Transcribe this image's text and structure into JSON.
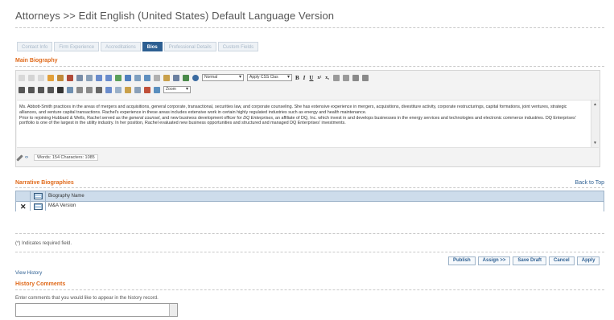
{
  "page": {
    "title": "Attorneys >> Edit English (United States) Default Language Version"
  },
  "tabs": [
    {
      "label": "Contact Info",
      "active": false
    },
    {
      "label": "Firm Experience",
      "active": false
    },
    {
      "label": "Accreditations",
      "active": false
    },
    {
      "label": "Bios",
      "active": true
    },
    {
      "label": "Professional Details",
      "active": false
    },
    {
      "label": "Custom Fields",
      "active": false
    }
  ],
  "main_bio": {
    "title": "Main Biography",
    "style_select": "Normal",
    "css_select": "Apply CSS Clas",
    "zoom_select": "Zoom",
    "bold": "B",
    "italic": "I",
    "underline": "U",
    "superscript": "x²",
    "subscript": "x₂",
    "paragraph1": "Ms. Abbott-Smith practices in the areas of mergers and acquisitions, general corporate, transactional, securities law, and corporate counseling. She has extensive experience in mergers, acquisitions, divestiture activity, corporate restructurings, capital formations, joint ventures, strategic alliances, and venture capital transactions. Rachel's experience in these areas includes extensive work in certain highly regulated industries such as energy and health maintenance.",
    "p2_a": "Prior to rejoining Hubbard & Wells, Rachel served as the ",
    "p2_em1": "general counsel",
    "p2_b": ", and new business development officer for ",
    "p2_em2": "DQ Enterprises",
    "p2_c": ", an affiliate of DQ, Inc. which invest in and develops businesses in the energy services and technologies and electronic commerce industries. DQ Enterprises' portfolio is one of the largest in the utility industry. In her position, Rachel evaluated new business opportunities and structured and managed DQ Enterprises' investments.",
    "word_count": "Words: 154 Characters: 1085"
  },
  "narrative": {
    "title": "Narrative Biographies",
    "back_to_top": "Back to Top",
    "column_header": "Biography Name",
    "delete_symbol": "✕",
    "rows": [
      {
        "name": "M&A Version"
      }
    ]
  },
  "required_note": "(*) Indicates required field.",
  "buttons": {
    "publish": "Publish",
    "assign": "Assign >>",
    "save_draft": "Save Draft",
    "cancel": "Cancel",
    "apply": "Apply"
  },
  "view_history": "View History",
  "history": {
    "title": "History Comments",
    "instruction": "Enter comments that you would like to appear in the history record."
  },
  "colors": {
    "accent_orange": "#e06a1b",
    "link_blue": "#2d5f92",
    "grid_header": "#cddceb"
  }
}
